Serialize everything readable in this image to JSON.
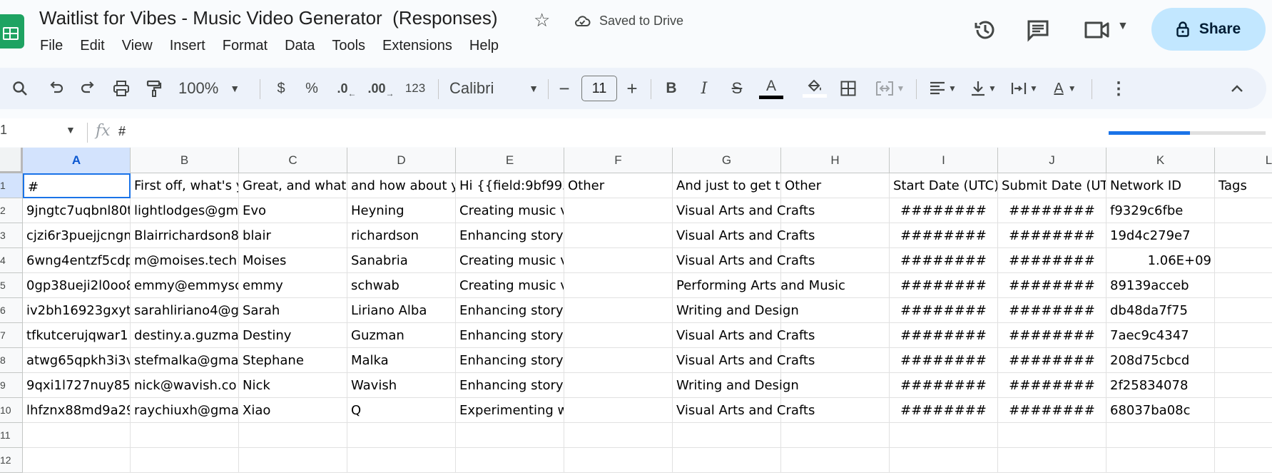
{
  "app": {
    "doc_title": "Waitlist for Vibes - Music Video Generator  (Responses)",
    "saved_status": "Saved to Drive",
    "share_label": "Share",
    "menu": [
      "File",
      "Edit",
      "View",
      "Insert",
      "Format",
      "Data",
      "Tools",
      "Extensions",
      "Help"
    ],
    "accent_color": "#1a73e8",
    "brand_color": "#1ea362"
  },
  "toolbar": {
    "zoom": "100%",
    "currency": "$",
    "percent": "%",
    "decrease_decimal": ".0",
    "increase_decimal": ".00",
    "number_format": "123",
    "font": "Calibri",
    "font_size": "11",
    "text_color": "A"
  },
  "formula_bar": {
    "name_box": "1",
    "fx": "fx",
    "content": "#",
    "load_progress": 0.52
  },
  "columns": [
    "A",
    "B",
    "C",
    "D",
    "E",
    "F",
    "G",
    "H",
    "I",
    "J",
    "K",
    "L"
  ],
  "rows": [
    "1",
    "2",
    "3",
    "4",
    "5",
    "6",
    "7",
    "8",
    "9",
    "10",
    "11",
    "12"
  ],
  "header_row": [
    "#",
    "First off, what's y",
    "Great, and what'",
    "and how about y",
    "Hi {{field:9bf993",
    "Other",
    "And just to get to",
    "Other",
    "Start Date (UTC)",
    "Submit Date (UT",
    "Network ID",
    "Tags"
  ],
  "data_rows": [
    [
      "9jngtc7uqbnl80t",
      "lightlodges@gm",
      "Evo",
      "Heyning",
      "Creating music videos for artistic",
      "",
      "Visual Arts and Crafts",
      "",
      "########",
      "########",
      "f9329c6fbe",
      ""
    ],
    [
      "cjzi6r3puejjcngm",
      "Blairrichardson8",
      "blair",
      "richardson",
      "Enhancing storytelling through vis",
      "",
      "Visual Arts and Crafts",
      "",
      "########",
      "########",
      "19d4c279e7",
      ""
    ],
    [
      "6wng4entzf5cdp",
      "m@moises.tech",
      "Moises",
      "Sanabria",
      "Creating music videos for artistic",
      "",
      "Visual Arts and Crafts",
      "",
      "########",
      "########",
      "1.06E+09",
      ""
    ],
    [
      "0gp38ueji2l0oo8",
      "emmy@emmysc",
      "emmy",
      "schwab",
      "Creating music videos for artistic",
      "",
      "Performing Arts and Music",
      "",
      "########",
      "########",
      "89139acceb",
      ""
    ],
    [
      "iv2bh16923gxyt",
      "sarahliriano4@g",
      "Sarah",
      "Liriano Alba",
      "Enhancing storytelling through vis",
      "",
      "Writing and Design",
      "",
      "########",
      "########",
      "db48da7f75",
      ""
    ],
    [
      "tfkutcerujqwar1",
      "destiny.a.guzma",
      "Destiny",
      "Guzman",
      "Enhancing storytelling through vis",
      "",
      "Visual Arts and Crafts",
      "",
      "########",
      "########",
      "7aec9c4347",
      ""
    ],
    [
      "atwg65qpkh3i3v",
      "stefmalka@gma",
      "Stephane",
      "Malka",
      "Enhancing storytelling through vis",
      "",
      "Visual Arts and Crafts",
      "",
      "########",
      "########",
      "208d75cbcd",
      ""
    ],
    [
      "9qxi1l727nuy85",
      "nick@wavish.co",
      "Nick",
      "Wavish",
      "Enhancing storytelling through vis",
      "",
      "Writing and Design",
      "",
      "########",
      "########",
      "2f25834078",
      ""
    ],
    [
      "lhfznx88md9a29",
      "raychiuxh@gma",
      "Xiao",
      "Q",
      "Experimenting with visual aesthe",
      "",
      "Visual Arts and Crafts",
      "",
      "########",
      "########",
      "68037ba08c",
      ""
    ]
  ]
}
